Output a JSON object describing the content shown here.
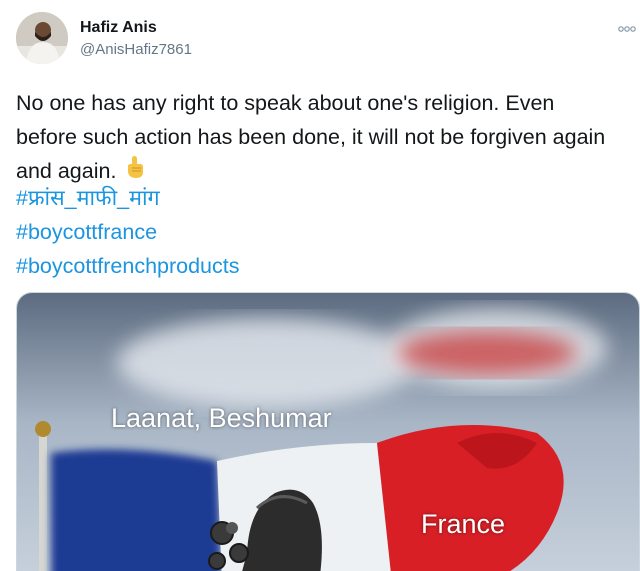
{
  "author": {
    "display_name": "Hafiz Anis",
    "handle": "@AnisHafiz7861"
  },
  "tweet": {
    "text": "No one has any right to speak about one's religion. Even before such action has been done, it will not be forgiven again and again.",
    "emoji_icon": "hand-pointing-up-icon",
    "hashtags": [
      "#फ्रांस_माफी_मांग",
      "#boycottfrance",
      "#boycottfrenchproducts"
    ]
  },
  "media": {
    "caption_top": "Laanat, Beshumar",
    "caption_flag": "France"
  },
  "colors": {
    "link": "#1b95e0",
    "text": "#14171a",
    "secondary": "#657786",
    "flag_blue": "#1f3a93",
    "flag_red": "#d81f26"
  }
}
